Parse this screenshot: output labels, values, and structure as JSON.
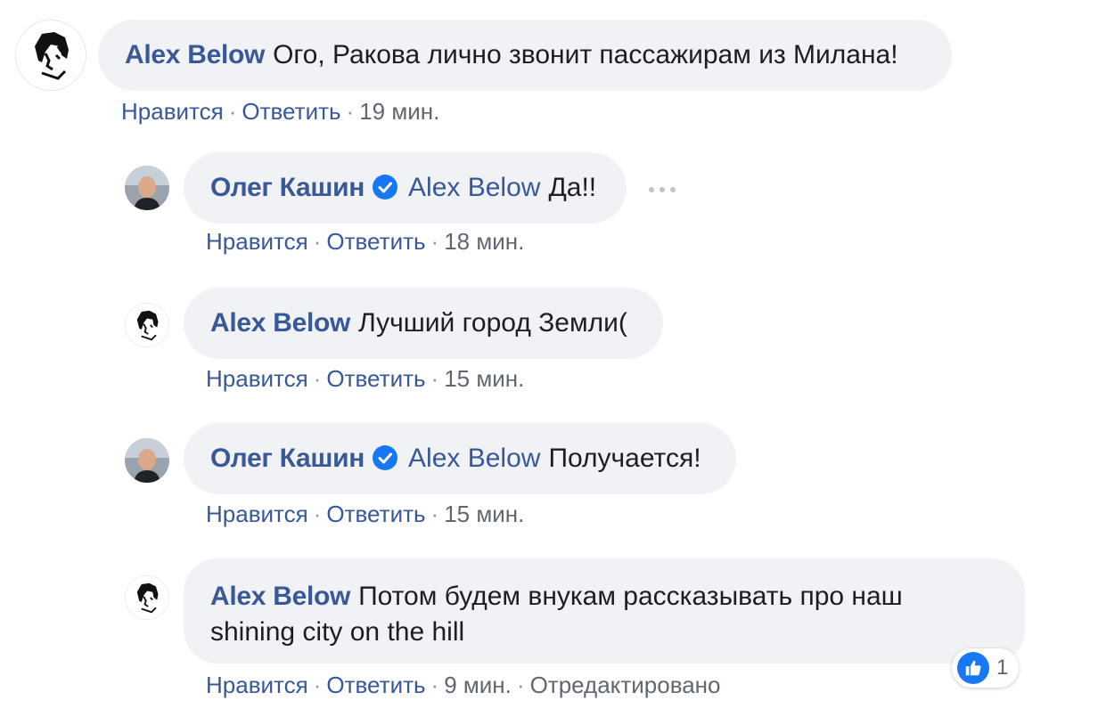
{
  "comments": [
    {
      "author": "Alex Below",
      "text": "Ого, Ракова лично звонит пассажирам из Милана!",
      "like_label": "Нравится",
      "reply_label": "Ответить",
      "time": "19 мин."
    },
    {
      "author": "Олег Кашин",
      "verified": true,
      "mention": "Alex Below",
      "text": "Да!!",
      "like_label": "Нравится",
      "reply_label": "Ответить",
      "time": "18 мин."
    },
    {
      "author": "Alex Below",
      "text": "Лучший город Земли(",
      "like_label": "Нравится",
      "reply_label": "Ответить",
      "time": "15 мин."
    },
    {
      "author": "Олег Кашин",
      "verified": true,
      "mention": "Alex Below",
      "text": "Получается!",
      "like_label": "Нравится",
      "reply_label": "Ответить",
      "time": "15 мин."
    },
    {
      "author": "Alex Below",
      "text_line1": "Потом будем внукам рассказывать про наш",
      "text_line2": "shining city on the hill",
      "like_label": "Нравится",
      "reply_label": "Ответить",
      "time": "9 мин.",
      "edited_label": "Отредактировано",
      "reaction_icon": "like-icon",
      "reaction_count": "1"
    }
  ],
  "colors": {
    "link": "#385898",
    "bubble": "#f0f2f5",
    "verified": "#1877f2",
    "meta": "#606770"
  }
}
